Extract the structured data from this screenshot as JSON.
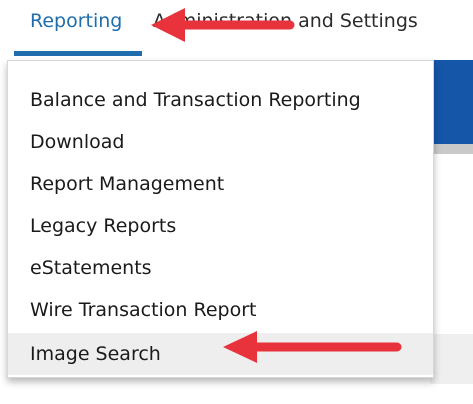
{
  "topnav": {
    "tabs": [
      {
        "label": "Reporting",
        "active": true
      },
      {
        "label": "Administration and Settings",
        "active": false
      }
    ]
  },
  "dropdown": {
    "items": [
      {
        "label": "Balance and Transaction Reporting"
      },
      {
        "label": "Download"
      },
      {
        "label": "Report Management"
      },
      {
        "label": "Legacy Reports"
      },
      {
        "label": "eStatements"
      },
      {
        "label": "Wire Transaction Report"
      },
      {
        "label": "Image Search",
        "highlighted": true
      }
    ]
  },
  "colors": {
    "accent": "#1f6dac",
    "annotation_arrow": "#e8323c",
    "highlight_row": "#eeeeee",
    "background_band": "#1556a8"
  },
  "annotations": [
    {
      "icon": "red-arrow-icon",
      "points_to": "Reporting"
    },
    {
      "icon": "red-arrow-icon",
      "points_to": "Image Search"
    }
  ]
}
